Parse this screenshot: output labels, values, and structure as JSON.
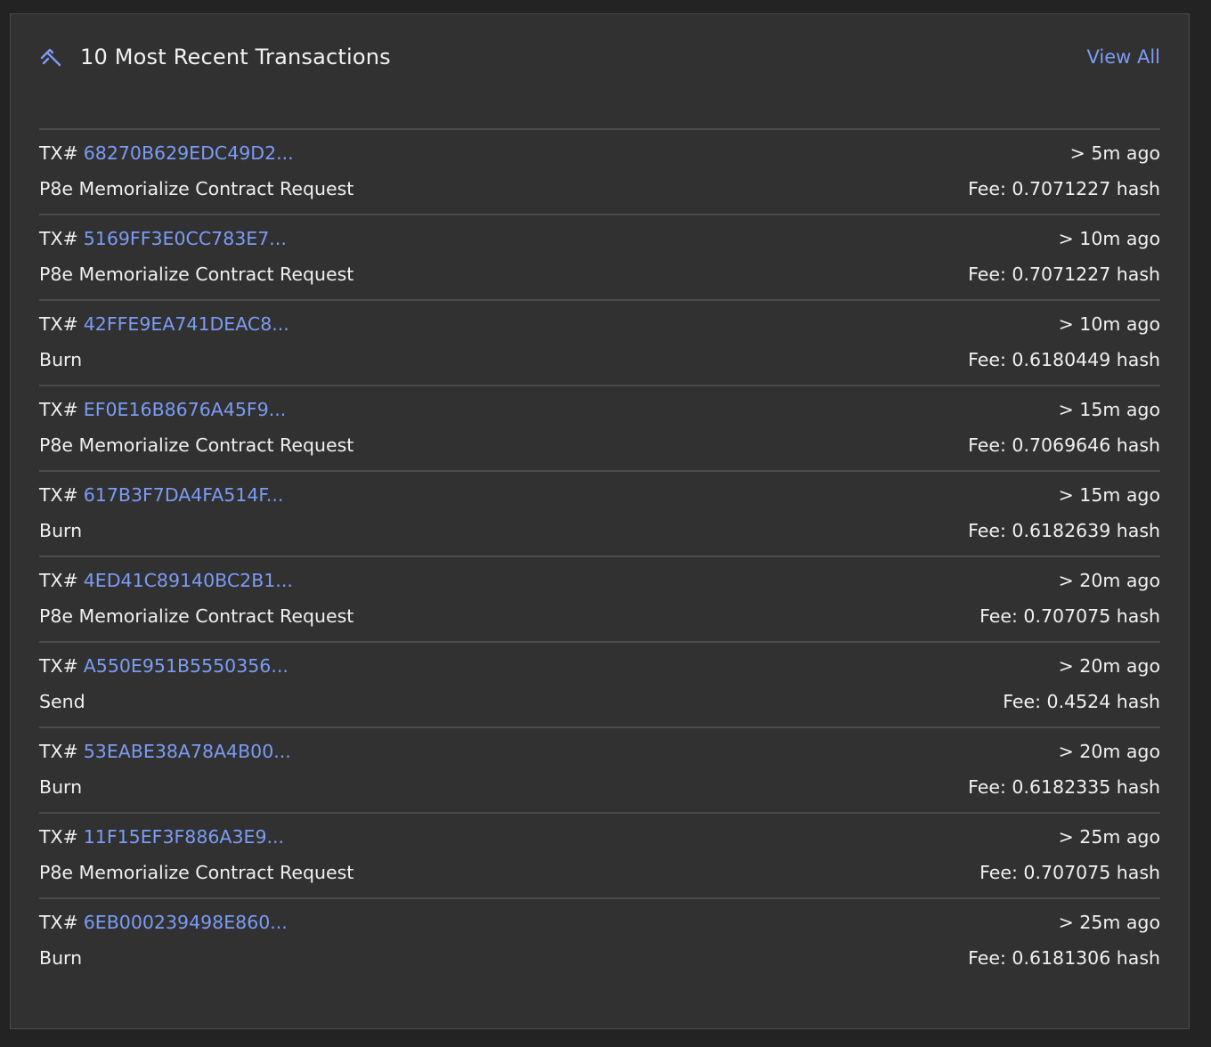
{
  "header": {
    "title": "10 Most Recent Transactions",
    "view_all_label": "View All",
    "icon": "hammer-icon",
    "accent_color": "#7b9cf5"
  },
  "transactions": [
    {
      "prefix": "TX#",
      "hash": "68270B629EDC49D2...",
      "age": "> 5m ago",
      "type": "P8e Memorialize Contract Request",
      "fee": "Fee: 0.7071227 hash"
    },
    {
      "prefix": "TX#",
      "hash": "5169FF3E0CC783E7...",
      "age": "> 10m ago",
      "type": "P8e Memorialize Contract Request",
      "fee": "Fee: 0.7071227 hash"
    },
    {
      "prefix": "TX#",
      "hash": "42FFE9EA741DEAC8...",
      "age": "> 10m ago",
      "type": "Burn",
      "fee": "Fee: 0.6180449 hash"
    },
    {
      "prefix": "TX#",
      "hash": "EF0E16B8676A45F9...",
      "age": "> 15m ago",
      "type": "P8e Memorialize Contract Request",
      "fee": "Fee: 0.7069646 hash"
    },
    {
      "prefix": "TX#",
      "hash": "617B3F7DA4FA514F...",
      "age": "> 15m ago",
      "type": "Burn",
      "fee": "Fee: 0.6182639 hash"
    },
    {
      "prefix": "TX#",
      "hash": "4ED41C89140BC2B1...",
      "age": "> 20m ago",
      "type": "P8e Memorialize Contract Request",
      "fee": "Fee: 0.707075 hash"
    },
    {
      "prefix": "TX#",
      "hash": "A550E951B5550356...",
      "age": "> 20m ago",
      "type": "Send",
      "fee": "Fee: 0.4524 hash"
    },
    {
      "prefix": "TX#",
      "hash": "53EABE38A78A4B00...",
      "age": "> 20m ago",
      "type": "Burn",
      "fee": "Fee: 0.6182335 hash"
    },
    {
      "prefix": "TX#",
      "hash": "11F15EF3F886A3E9...",
      "age": "> 25m ago",
      "type": "P8e Memorialize Contract Request",
      "fee": "Fee: 0.707075 hash"
    },
    {
      "prefix": "TX#",
      "hash": "6EB000239498E860...",
      "age": "> 25m ago",
      "type": "Burn",
      "fee": "Fee: 0.6181306 hash"
    }
  ]
}
